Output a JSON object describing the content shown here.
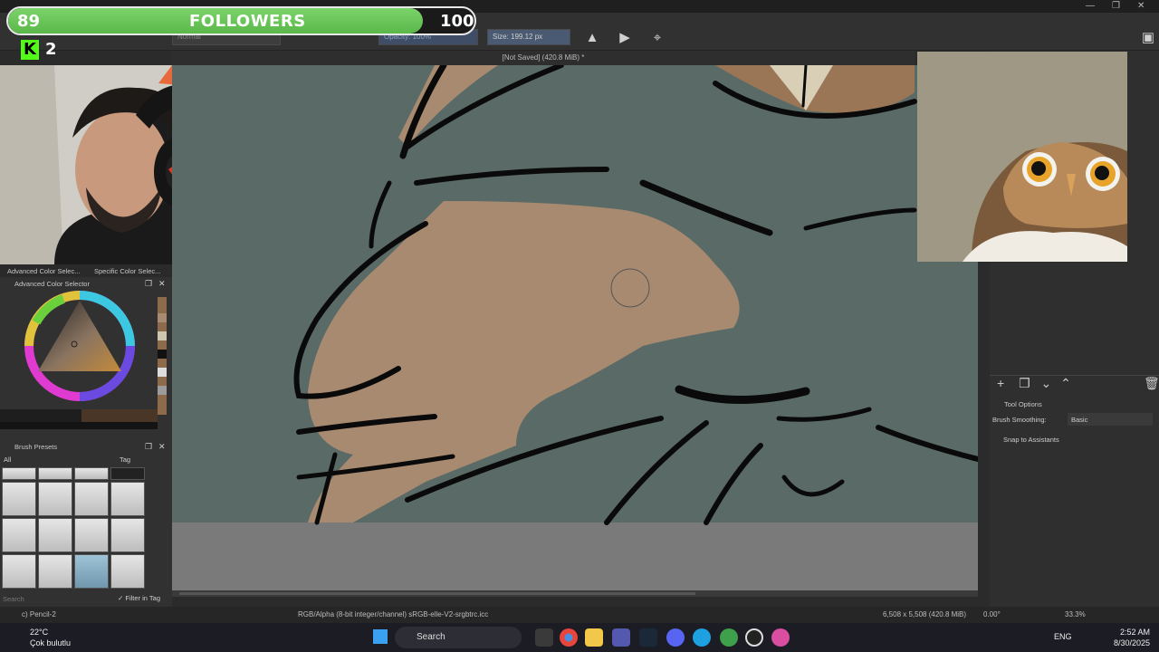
{
  "titlebar": {
    "title": "",
    "minimize": "—",
    "maximize": "❐",
    "close": "✕"
  },
  "followers_widget": {
    "current": "89",
    "label": "FOLLOWERS",
    "goal": "100",
    "progress": 0.89,
    "accent": "#5bb84a"
  },
  "kick": {
    "logo_letter": "K",
    "count": "2",
    "accent": "#53fc18"
  },
  "toolbar": {
    "blend_mode": "Normal",
    "opacity": "Opacity: 100%",
    "size": "Size: 199.12 px",
    "mirror_h_icon": "mirror-horizontal-icon",
    "mirror_v_icon": "mirror-vertical-icon",
    "wrap_icon": "wrap-around-icon"
  },
  "document": {
    "title": "[Not Saved]  (420.8 MiB) *"
  },
  "left_docker": {
    "tabs": [
      "Advanced Color Selec...",
      "Specific Color Selec..."
    ],
    "color_panel_title": "Advanced Color Selector",
    "brush_panel_title": "Brush Presets",
    "brush_filter": "All",
    "tag_label": "Tag",
    "search_placeholder": "Search",
    "filter_in_tag": "Filter in Tag"
  },
  "right_docker": {
    "tool_options_title": "Tool Options",
    "brush_smoothing_label": "Brush Smoothing:",
    "brush_smoothing_value": "Basic",
    "snap_label": "Snap to Assistants"
  },
  "statusbar": {
    "brush": "c) Pencil-2",
    "color_profile": "RGB/Alpha (8-bit integer/channel)  sRGB-elle-V2-srgbtrc.icc",
    "dimensions": "6,508 x 5,508 (420.8 MiB)",
    "rotation": "0.00°",
    "zoom": "33.3%"
  },
  "taskbar": {
    "weather_temp": "22°C",
    "weather_desc": "Çok bulutlu",
    "search_placeholder": "Search",
    "language": "ENG",
    "time": "2:52 AM",
    "date": "8/30/2025"
  },
  "colors": {
    "canvas_bg": "#5a6b67",
    "skin": "#a88a70",
    "ref_bg": "#9f9884"
  }
}
